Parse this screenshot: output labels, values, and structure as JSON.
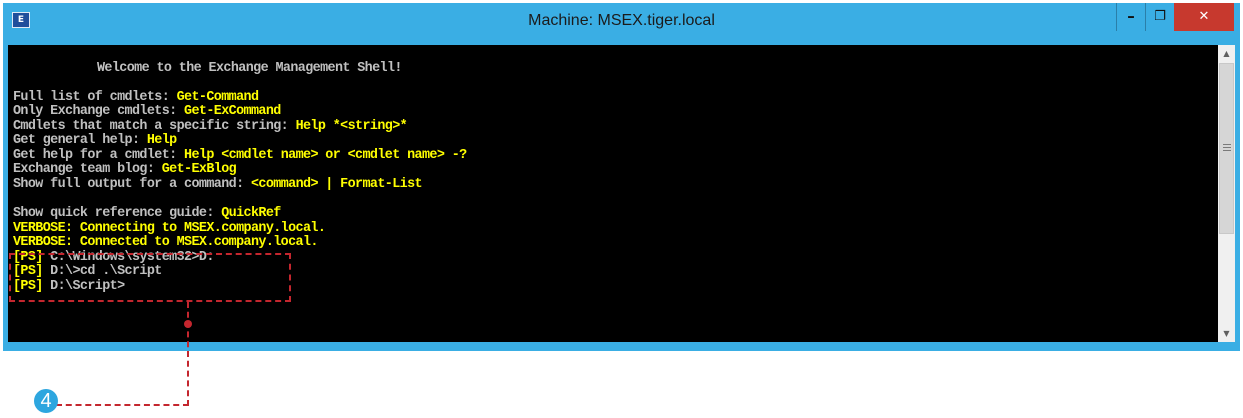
{
  "window": {
    "title": "Machine: MSEX.tiger.local",
    "app_icon": "E",
    "minimize_glyph": "–",
    "maximize_glyph": "❐",
    "close_glyph": "✕"
  },
  "console": {
    "welcome": "Welcome to the Exchange Management Shell!",
    "help_lines": [
      {
        "label": "Full list of cmdlets: ",
        "cmd": "Get-Command"
      },
      {
        "label": "Only Exchange cmdlets: ",
        "cmd": "Get-ExCommand"
      },
      {
        "label": "Cmdlets that match a specific string: ",
        "cmd": "Help *<string>*"
      },
      {
        "label": "Get general help: ",
        "cmd": "Help"
      },
      {
        "label": "Get help for a cmdlet: ",
        "cmd": "Help <cmdlet name> or <cmdlet name> -?"
      },
      {
        "label": "Exchange team blog: ",
        "cmd": "Get-ExBlog"
      },
      {
        "label": "Show full output for a command: ",
        "cmd": "<command> | Format-List"
      }
    ],
    "quickref": {
      "label": "Show quick reference guide: ",
      "cmd": "QuickRef"
    },
    "verbose": [
      "VERBOSE: Connecting to MSEX.company.local.",
      "VERBOSE: Connected to MSEX.company.local."
    ],
    "prompts": [
      {
        "tag": "[PS]",
        "text": " C:\\Windows\\system32>D:"
      },
      {
        "tag": "[PS]",
        "text": " D:\\>cd .\\Script"
      },
      {
        "tag": "[PS]",
        "text": " D:\\Script>"
      }
    ]
  },
  "callout": {
    "number": "4",
    "color": "#c4262e"
  },
  "colors": {
    "window_frame": "#3aaee4",
    "console_bg": "#000000",
    "console_text": "#c0c0c0",
    "highlight": "#ffff00",
    "close_button": "#c7392e"
  }
}
